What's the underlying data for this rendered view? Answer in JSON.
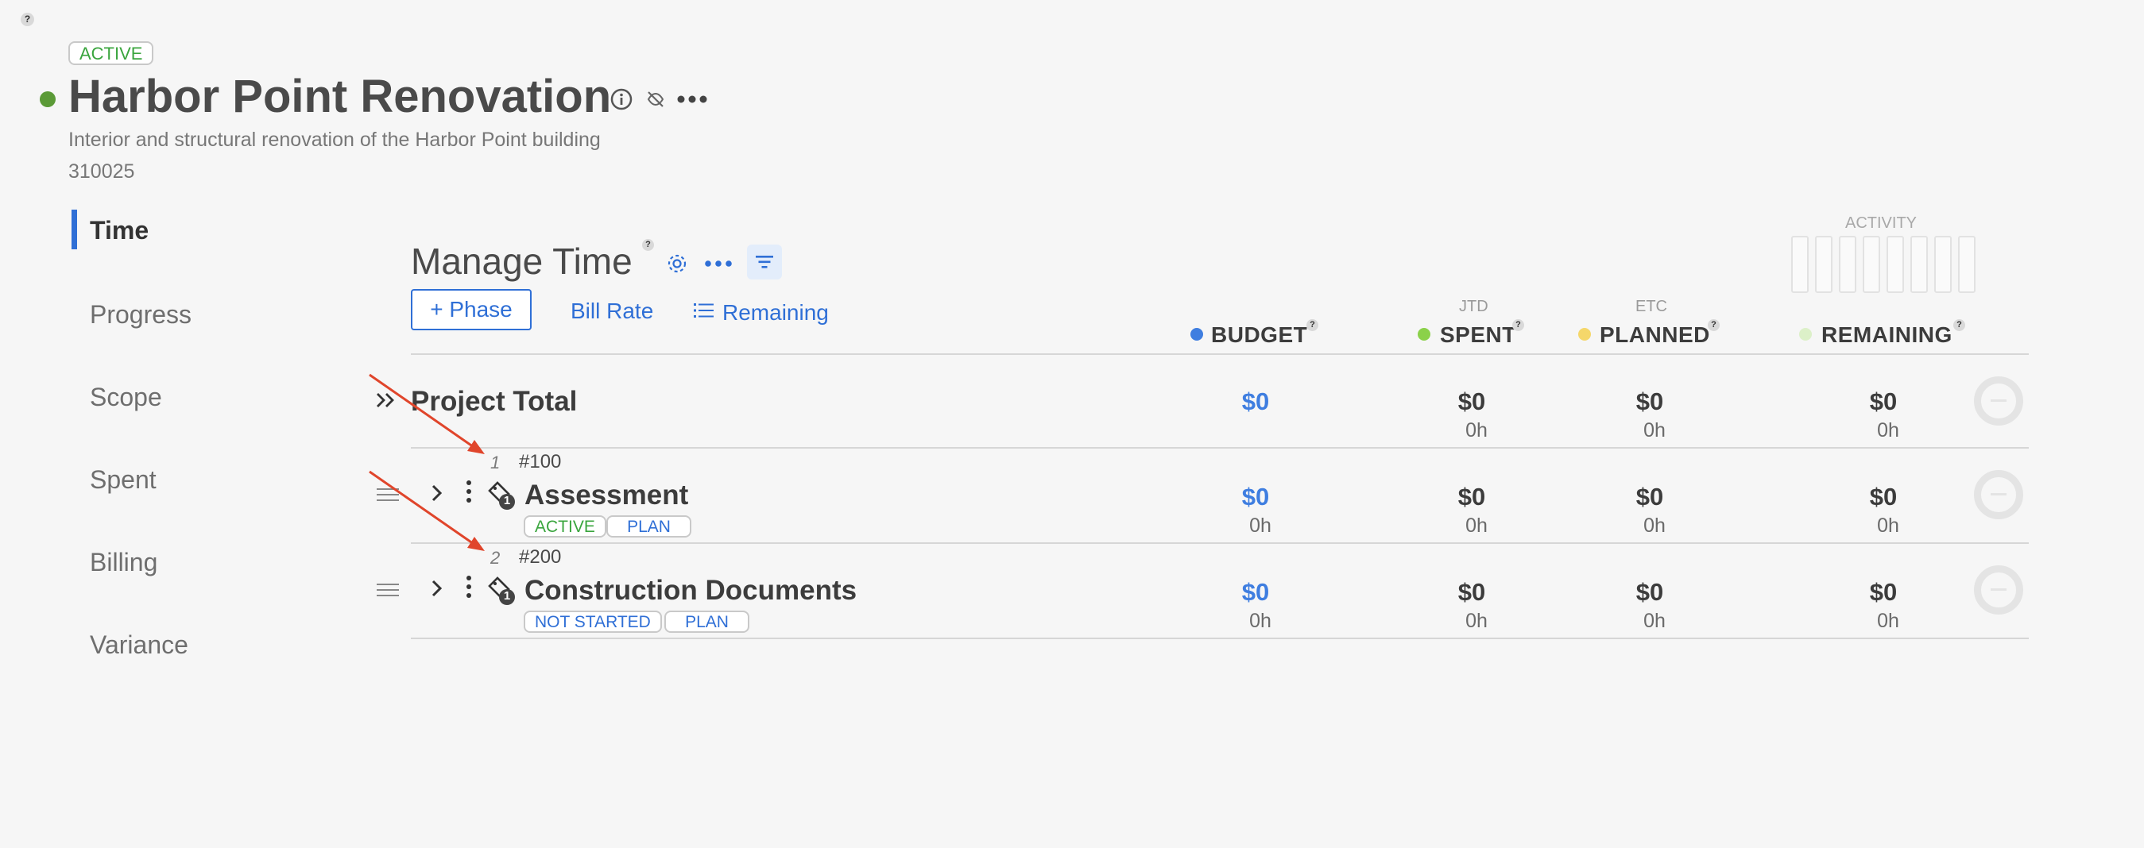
{
  "help_mark": "?",
  "project": {
    "status": "ACTIVE",
    "title": "Harbor Point Renovation",
    "description": "Interior and structural renovation of the Harbor Point building",
    "number": "310025"
  },
  "sidebar": {
    "items": [
      {
        "label": "Time",
        "active": true
      },
      {
        "label": "Progress"
      },
      {
        "label": "Scope"
      },
      {
        "label": "Spent"
      },
      {
        "label": "Billing"
      },
      {
        "label": "Variance"
      }
    ]
  },
  "manage": {
    "title": "Manage Time",
    "add_phase": "+ Phase",
    "bill_rate": "Bill Rate",
    "remaining": "Remaining",
    "activity_label": "ACTIVITY"
  },
  "columns": {
    "budget": {
      "label": "BUDGET",
      "sub": "",
      "color": "#3f7ee0"
    },
    "spent": {
      "label": "SPENT",
      "sub": "JTD",
      "color": "#8bd14a"
    },
    "planned": {
      "label": "PLANNED",
      "sub": "ETC",
      "color": "#f5d76a"
    },
    "remaining": {
      "label": "REMAINING",
      "sub": "",
      "color": "#dcf0c8"
    }
  },
  "project_total": {
    "label": "Project Total",
    "budget": "$0",
    "spent": "$0",
    "spent_hours": "0h",
    "planned": "$0",
    "planned_hours": "0h",
    "remaining": "$0",
    "remaining_hours": "0h"
  },
  "phases": [
    {
      "index": "1",
      "code": "#100",
      "name": "Assessment",
      "badge_count": "1",
      "status": "ACTIVE",
      "tag": "PLAN",
      "budget": "$0",
      "budget_hours": "0h",
      "spent": "$0",
      "spent_hours": "0h",
      "planned": "$0",
      "planned_hours": "0h",
      "remaining": "$0",
      "remaining_hours": "0h"
    },
    {
      "index": "2",
      "code": "#200",
      "name": "Construction Documents",
      "badge_count": "1",
      "status": "NOT STARTED",
      "tag": "PLAN",
      "budget": "$0",
      "budget_hours": "0h",
      "spent": "$0",
      "spent_hours": "0h",
      "planned": "$0",
      "planned_hours": "0h",
      "remaining": "$0",
      "remaining_hours": "0h"
    }
  ],
  "colors": {
    "accent_blue": "#2f6fd6",
    "status_green": "#3aa53e",
    "annotation_arrow": "#e0452b"
  }
}
